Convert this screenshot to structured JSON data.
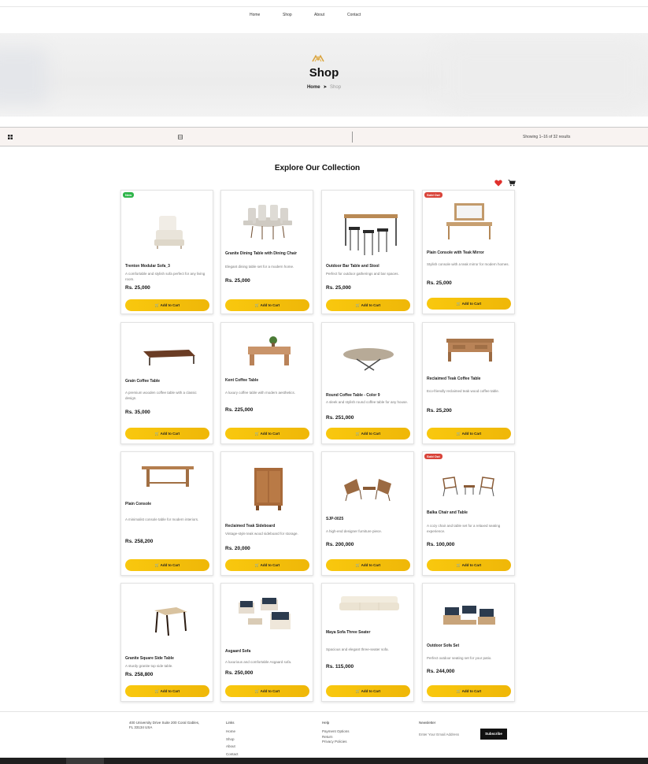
{
  "nav": {
    "items": [
      "Home",
      "Shop",
      "About",
      "Contact"
    ]
  },
  "hero": {
    "title": "Shop",
    "breadcrumb_home": "Home",
    "breadcrumb_current": "Shop"
  },
  "toolbar": {
    "showing": "Showing 1–16 of 32 results"
  },
  "section": {
    "title": "Explore Our Collection"
  },
  "colors": {
    "accent": "#f5c10c",
    "new_badge": "#2fb54a",
    "sold_badge": "#d9443a",
    "heart": "#e0302c"
  },
  "products": [
    {
      "badge": "New",
      "name": "Trenton Modular Sofa_3",
      "desc": "A comfortable and stylish sofa perfect for any living room.",
      "price": "Rs. 25,000",
      "cta": "Add to Cart"
    },
    {
      "badge": "",
      "name": "Granite Dining Table with Dining Chair",
      "desc": "Elegant dining table set for a modern home.",
      "price": "Rs. 25,000",
      "cta": "Add to Cart"
    },
    {
      "badge": "",
      "name": "Outdoor Bar Table and Stool",
      "desc": "Perfect for outdoor gatherings and bar spaces.",
      "price": "Rs. 25,000",
      "cta": "Add to Cart"
    },
    {
      "badge": "Sold Out",
      "name": "Plain Console with Teak Mirror",
      "desc": "Stylish console with a teak mirror for modern homes.",
      "price": "Rs. 25,000",
      "cta": "Add to Cart"
    },
    {
      "badge": "",
      "name": "Grain Coffee Table",
      "desc": "A premium wooden coffee table with a classic design.",
      "price": "Rs. 35,000",
      "cta": "Add to Cart"
    },
    {
      "badge": "",
      "name": "Kent Coffee Table",
      "desc": "A luxury coffee table with modern aesthetics.",
      "price": "Rs. 225,000",
      "cta": "Add to Cart"
    },
    {
      "badge": "",
      "name": "Round Coffee Table - Color 9",
      "desc": "A sleek and stylish round coffee table for any house.",
      "price": "Rs. 251,000",
      "cta": "Add to Cart"
    },
    {
      "badge": "",
      "name": "Reclaimed Teak Coffee Table",
      "desc": "Eco-friendly reclaimed teak wood coffee table.",
      "price": "Rs. 25,200",
      "cta": "Add to Cart"
    },
    {
      "badge": "",
      "name": "Plain Console",
      "desc": "A minimalist console table for modern interiors.",
      "price": "Rs. 258,200",
      "cta": "Add to Cart"
    },
    {
      "badge": "",
      "name": "Reclaimed Teak Sideboard",
      "desc": "Vintage-style teak wood sideboard for storage.",
      "price": "Rs. 20,000",
      "cta": "Add to Cart"
    },
    {
      "badge": "",
      "name": "SJP-0025",
      "desc": "A high-end designer furniture piece.",
      "price": "Rs. 200,000",
      "cta": "Add to Cart"
    },
    {
      "badge": "Sold Out",
      "name": "Balka Chair and Table",
      "desc": "A cozy chair and table set for a relaxed seating experience.",
      "price": "Rs. 100,000",
      "cta": "Add to Cart"
    },
    {
      "badge": "",
      "name": "Granite Square Side Table",
      "desc": "A sturdy granite top side table.",
      "price": "Rs. 258,800",
      "cta": "Add to Cart"
    },
    {
      "badge": "",
      "name": "Asgaard Sofa",
      "desc": "A luxurious and comfortable Asgaard sofa.",
      "price": "Rs. 250,000",
      "cta": "Add to Cart"
    },
    {
      "badge": "",
      "name": "Maya Sofa Three Seater",
      "desc": "Spacious and elegant three-seater sofa.",
      "price": "Rs. 115,000",
      "cta": "Add to Cart"
    },
    {
      "badge": "",
      "name": "Outdoor Sofa Set",
      "desc": "Perfect outdoor seating set for your patio.",
      "price": "Rs. 244,000",
      "cta": "Add to Cart"
    }
  ],
  "footer": {
    "address_line1": "400 University Drive Suite 200 Coral Gables,",
    "address_line2": "FL 33134 USA",
    "links_title": "Links",
    "links": [
      "Home",
      "Shop",
      "About",
      "Contact"
    ],
    "help_title": "Help",
    "help": [
      "Payment Options",
      "Return",
      "Privacy Policies"
    ],
    "newsletter_title": "Newsletter",
    "email_placeholder": "Enter Your Email Address",
    "subscribe": "Subscribe"
  }
}
